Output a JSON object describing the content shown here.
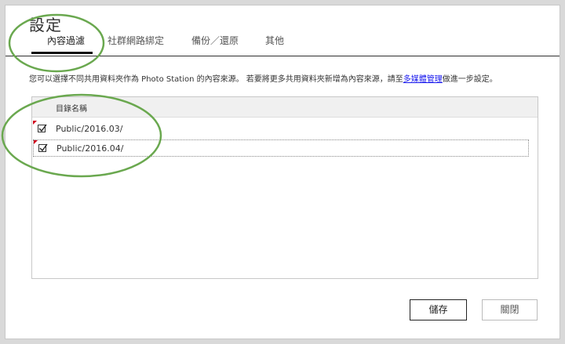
{
  "dialog": {
    "title": "設定"
  },
  "tabs": [
    {
      "label": "內容過濾",
      "active": true
    },
    {
      "label": "社群網路綁定",
      "active": false
    },
    {
      "label": "備份／還原",
      "active": false
    },
    {
      "label": "其他",
      "active": false
    }
  ],
  "description": {
    "text_before": "您可以選擇不同共用資料夾作為 Photo Station 的內容來源。 若要將更多共用資料夾新增為內容來源，請至",
    "link": "多媒體管理",
    "text_after": "做進一步設定。"
  },
  "folder_list": {
    "header": "目錄名稱",
    "rows": [
      {
        "label": "Public/2016.03/",
        "checked": true,
        "modified": true
      },
      {
        "label": "Public/2016.04/",
        "checked": true,
        "modified": true
      }
    ]
  },
  "buttons": {
    "save": "儲存",
    "close": "關閉"
  },
  "colors": {
    "annotation_green": "#6aa84f",
    "modified_marker": "#d0021b",
    "link_blue": "#1a1aee"
  }
}
